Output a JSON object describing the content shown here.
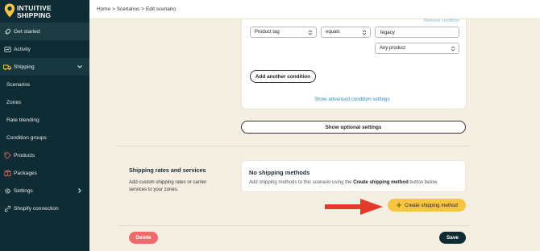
{
  "app": {
    "logo_line1": "INTUITIVE",
    "logo_line2": "SHIPPING",
    "logo_icon": "location-pin-icon"
  },
  "sidebar": {
    "items": [
      {
        "label": "Get started",
        "icon": "rocket-icon"
      },
      {
        "label": "Activity",
        "icon": "activity-icon"
      },
      {
        "label": "Shipping",
        "icon": "truck-icon"
      },
      {
        "label": "Scenarios"
      },
      {
        "label": "Zones"
      },
      {
        "label": "Rate blending"
      },
      {
        "label": "Condition groups"
      },
      {
        "label": "Products",
        "icon": "tag-icon"
      },
      {
        "label": "Packages",
        "icon": "box-icon"
      },
      {
        "label": "Settings",
        "icon": "gear-icon"
      },
      {
        "label": "Shopify connection",
        "icon": "link-icon"
      }
    ]
  },
  "breadcrumb": {
    "home": "Home",
    "sep1": ">",
    "scenarios": "Scenarios",
    "sep2": ">",
    "current": "Edit scenario"
  },
  "conditions": {
    "field": "Product tag",
    "operator": "equals",
    "value": "legacy",
    "scope": "Any product",
    "remove_link_cut": "Remove condition",
    "add_button": "Add another condition",
    "advanced_link": "Show advanced condition settings"
  },
  "optional": {
    "button": "Show optional settings"
  },
  "rates": {
    "title": "Shipping rates and services",
    "description": "Add custom shipping rates or carrier services to your zones.",
    "empty_title": "No shipping methods",
    "empty_text_pre": "Add shipping methods to this scenario using the ",
    "empty_text_bold": "Create shipping method",
    "empty_text_post": " button below.",
    "create_button": "Create shipping method"
  },
  "footer": {
    "delete": "Delete",
    "save": "Save"
  },
  "colors": {
    "sidebar_bg": "#0f2b33",
    "page_bg": "#f5efe3",
    "accent_yellow": "#f6c542",
    "delete_red": "#ef6a6a",
    "link_blue": "#2f8fb5",
    "arrow_red": "#e53a2a"
  }
}
